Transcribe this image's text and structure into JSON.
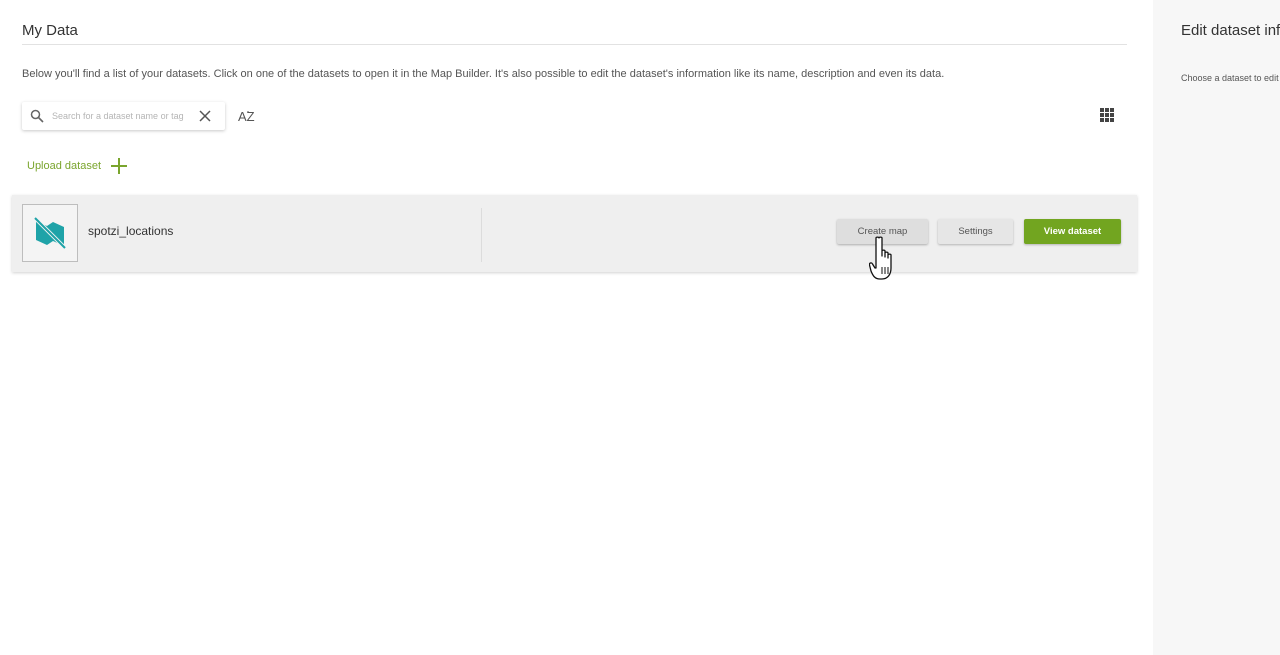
{
  "main": {
    "title": "My Data",
    "intro": "Below you'll find a list of your datasets. Click on one of the datasets to open it in the Map Builder. It's also possible to edit the dataset's information like its name, description and even its data.",
    "search": {
      "placeholder": "Search for a dataset name or tag",
      "value": ""
    },
    "sort_label": "AZ",
    "upload_label": "Upload dataset",
    "datasets": [
      {
        "name": "spotzi_locations",
        "thumbnail_icon": "no-image-icon",
        "actions": {
          "create_map": "Create map",
          "settings": "Settings",
          "view": "View dataset"
        }
      }
    ]
  },
  "side_panel": {
    "title": "Edit dataset information",
    "hint": "Choose a dataset to edit its information"
  },
  "colors": {
    "accent": "#72a520",
    "thumbnail_icon": "#1fa3a8"
  }
}
